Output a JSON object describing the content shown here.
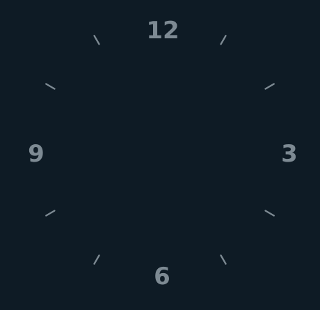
{
  "clock": {
    "background_color": "#0e1b25",
    "mark_color": "#7d8a93",
    "numerals": {
      "twelve": "12",
      "three": "3",
      "six": "6",
      "nine": "9"
    },
    "tick_hours": [
      1,
      2,
      4,
      5,
      7,
      8,
      10,
      11
    ]
  }
}
